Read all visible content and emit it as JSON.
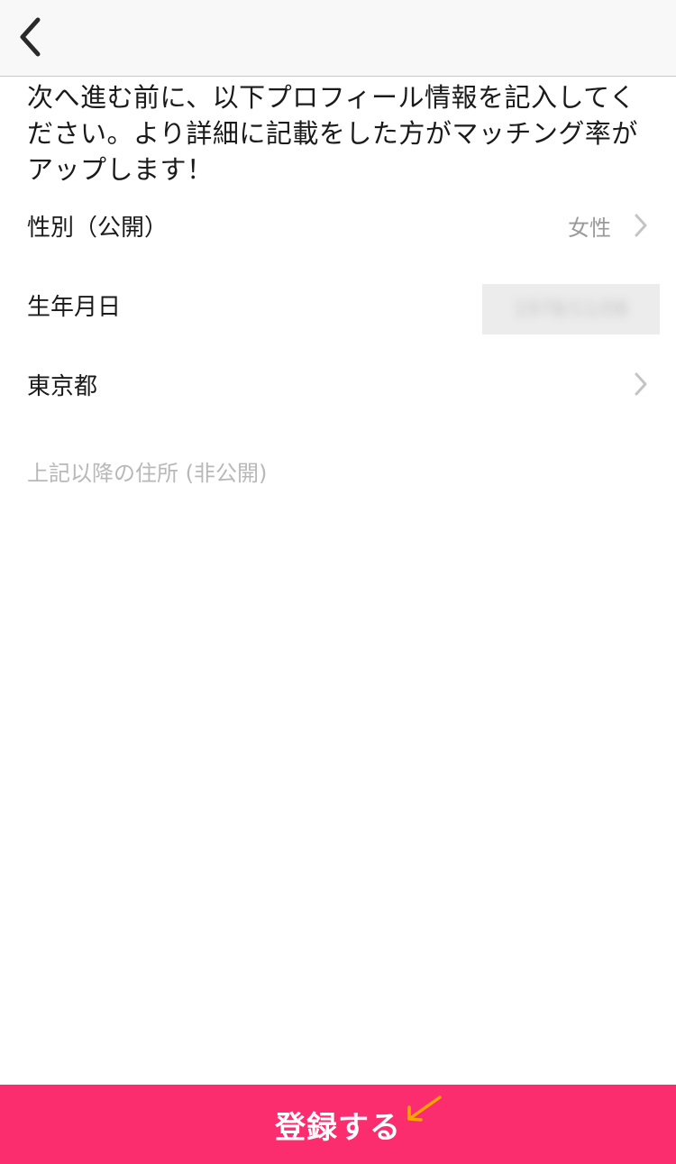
{
  "nav": {
    "back_icon": "chevron-left-icon"
  },
  "intro_text": "次へ進む前に、以下プロフィール情報を記入してください。より詳細に記載をした方がマッチング率がアップします！",
  "profile": {
    "gender": {
      "label": "性別（公開）",
      "value": "女性"
    },
    "birthday": {
      "label": "生年月日",
      "value": "1978/11/08"
    },
    "prefecture": {
      "label": "東京都"
    },
    "address": {
      "placeholder": "上記以降の住所 (非公開)",
      "value": ""
    }
  },
  "footer": {
    "register_label": "登録する"
  },
  "colors": {
    "accent": "#fc2d6f",
    "annotation_arrow": "#f6a500",
    "value_gray": "#9a9a9a",
    "nav_background": "#f8f8f8"
  }
}
